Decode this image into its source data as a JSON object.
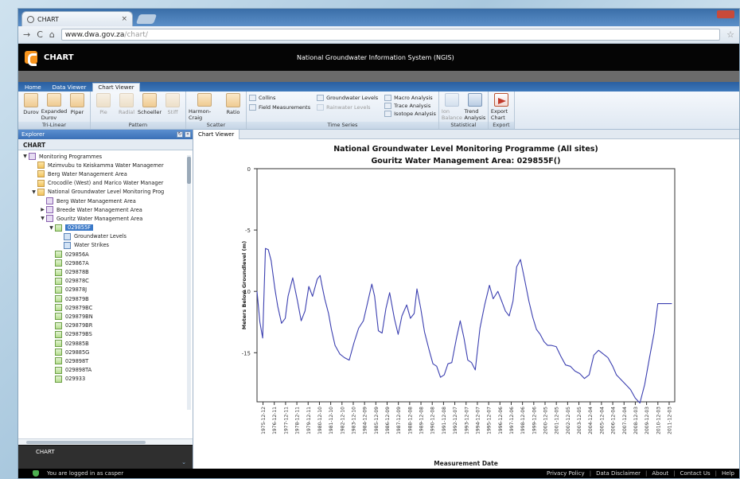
{
  "browser": {
    "tab_title": "CHART",
    "url_host": "www.dwa.gov.za",
    "url_path": "/chart/"
  },
  "app": {
    "name": "CHART",
    "system_title": "National Groundwater Information System (NGIS)"
  },
  "ribbon": {
    "tabs": [
      "Home",
      "Data Viewer",
      "Chart Viewer"
    ],
    "active_tab": "Chart Viewer",
    "groups": {
      "trilinear": {
        "name": "Tri-Linear",
        "buttons": [
          "Durov",
          "Expanded Durov",
          "Piper"
        ]
      },
      "pattern": {
        "name": "Pattern",
        "buttons": [
          "Pie",
          "Radial",
          "Schoeller",
          "Stiff"
        ]
      },
      "scatter": {
        "name": "Scatter",
        "buttons": [
          "Harmon-Craig",
          "Ratio"
        ]
      },
      "timeseries": {
        "name": "Time Series",
        "col1": [
          "Collins",
          "Field Measurements"
        ],
        "col2": [
          "Groundwater Levels",
          "Rainwater Levels"
        ],
        "col3": [
          "Macro Analysis",
          "Trace Analysis",
          "Isotope Analysis"
        ]
      },
      "statistical": {
        "name": "Statistical",
        "buttons": [
          "Ion Balance",
          "Trend Analysis"
        ]
      },
      "export": {
        "name": "Export",
        "buttons": [
          "Export Chart"
        ]
      }
    }
  },
  "explorer": {
    "panel_title": "Explorer",
    "root_label": "CHART",
    "tree": [
      {
        "level": 0,
        "toggle": "▼",
        "icon": "prog",
        "label": "Monitoring Programmes"
      },
      {
        "level": 1,
        "toggle": "",
        "icon": "folder",
        "label": "Mzimvubu to Keiskamma Water Managemer"
      },
      {
        "level": 1,
        "toggle": "",
        "icon": "folder",
        "label": "Berg Water Management Area"
      },
      {
        "level": 1,
        "toggle": "",
        "icon": "folder",
        "label": "Crocodile (West) and Marico Water Manager"
      },
      {
        "level": 1,
        "toggle": "▼",
        "icon": "folder",
        "label": "National Groundwater Level Monitoring Prog"
      },
      {
        "level": 2,
        "toggle": "",
        "icon": "prog",
        "label": "Berg Water Management Area"
      },
      {
        "level": 2,
        "toggle": "▶",
        "icon": "prog",
        "label": "Breede Water Management Area"
      },
      {
        "level": 2,
        "toggle": "▼",
        "icon": "prog",
        "label": "Gouritz Water Management Area"
      },
      {
        "level": 3,
        "toggle": "▼",
        "icon": "site",
        "label": "029855F",
        "selected": true
      },
      {
        "level": 4,
        "toggle": "",
        "icon": "level",
        "label": "Groundwater Levels"
      },
      {
        "level": 4,
        "toggle": "",
        "icon": "level",
        "label": "Water Strikes"
      },
      {
        "level": 3,
        "toggle": "",
        "icon": "site",
        "label": "029856A"
      },
      {
        "level": 3,
        "toggle": "",
        "icon": "site",
        "label": "029867A"
      },
      {
        "level": 3,
        "toggle": "",
        "icon": "site",
        "label": "029878B"
      },
      {
        "level": 3,
        "toggle": "",
        "icon": "site",
        "label": "029878C"
      },
      {
        "level": 3,
        "toggle": "",
        "icon": "site",
        "label": "029878J"
      },
      {
        "level": 3,
        "toggle": "",
        "icon": "site",
        "label": "029879B"
      },
      {
        "level": 3,
        "toggle": "",
        "icon": "site",
        "label": "029879BC"
      },
      {
        "level": 3,
        "toggle": "",
        "icon": "site",
        "label": "029879BN"
      },
      {
        "level": 3,
        "toggle": "",
        "icon": "site",
        "label": "029879BR"
      },
      {
        "level": 3,
        "toggle": "",
        "icon": "site",
        "label": "029879BS"
      },
      {
        "level": 3,
        "toggle": "",
        "icon": "site",
        "label": "029885B"
      },
      {
        "level": 3,
        "toggle": "",
        "icon": "site",
        "label": "029885G"
      },
      {
        "level": 3,
        "toggle": "",
        "icon": "site",
        "label": "029898T"
      },
      {
        "level": 3,
        "toggle": "",
        "icon": "site",
        "label": "029898TA"
      },
      {
        "level": 3,
        "toggle": "",
        "icon": "site",
        "label": "029933"
      }
    ],
    "bottom_panel_title": "CHART"
  },
  "viewer": {
    "tab_label": "Chart Viewer"
  },
  "chart_data": {
    "type": "line",
    "title": "National Groundwater Level Monitoring Programme (All sites)",
    "subtitle": "Gouritz Water Management Area: 029855F()",
    "xlabel": "Measurement Date",
    "ylabel": "Meters Below Groundlevel (m)",
    "ylim": [
      0,
      -19
    ],
    "yticks": [
      0,
      -5,
      -10,
      -15
    ],
    "xlim": [
      "1975-06-01",
      "2012-06-01"
    ],
    "xticks": [
      "1975-12-12",
      "1976-12-11",
      "1977-12-11",
      "1978-12-11",
      "1979-12-11",
      "1980-12-10",
      "1981-12-10",
      "1982-12-10",
      "1983-12-10",
      "1984-12-09",
      "1985-12-09",
      "1986-12-09",
      "1987-12-09",
      "1988-12-08",
      "1989-12-08",
      "1990-12-08",
      "1991-12-08",
      "1992-12-07",
      "1993-12-07",
      "1994-12-07",
      "1995-12-07",
      "1996-12-06",
      "1997-12-06",
      "1998-12-06",
      "1999-12-06",
      "2000-12-05",
      "2001-12-05",
      "2002-12-05",
      "2003-12-05",
      "2004-12-04",
      "2005-12-04",
      "2006-12-04",
      "2007-12-04",
      "2008-12-03",
      "2009-12-03",
      "2010-12-03",
      "2011-12-03"
    ],
    "grid": false,
    "series": [
      {
        "color": "#3b3fb0",
        "x": [
          "1975-06-01",
          "1975-09-01",
          "1975-12-01",
          "1976-03-01",
          "1976-06-01",
          "1976-09-01",
          "1977-01-01",
          "1977-04-01",
          "1977-08-01",
          "1977-12-01",
          "1978-03-01",
          "1978-08-01",
          "1979-01-01",
          "1979-05-01",
          "1979-09-01",
          "1980-01-01",
          "1980-05-01",
          "1980-10-01",
          "1981-01-01",
          "1981-03-01",
          "1981-06-01",
          "1981-10-01",
          "1982-01-01",
          "1982-05-01",
          "1982-10-01",
          "1983-03-01",
          "1983-08-01",
          "1984-01-01",
          "1984-06-01",
          "1984-11-01",
          "1985-03-01",
          "1985-08-01",
          "1985-11-01",
          "1986-03-01",
          "1986-07-01",
          "1986-11-01",
          "1987-03-01",
          "1987-08-01",
          "1987-12-01",
          "1988-04-01",
          "1988-09-01",
          "1989-01-01",
          "1989-05-01",
          "1989-08-01",
          "1989-12-01",
          "1990-04-01",
          "1990-09-01",
          "1991-01-01",
          "1991-05-01",
          "1991-09-01",
          "1992-01-01",
          "1992-05-01",
          "1992-09-01",
          "1993-02-01",
          "1993-06-01",
          "1993-10-01",
          "1994-02-01",
          "1994-06-01",
          "1994-10-01",
          "1995-03-01",
          "1995-08-01",
          "1996-01-01",
          "1996-05-01",
          "1996-10-01",
          "1997-02-01",
          "1997-06-01",
          "1997-10-01",
          "1998-02-01",
          "1998-06-01",
          "1998-10-01",
          "1999-02-01",
          "1999-07-01",
          "1999-11-01",
          "2000-03-01",
          "2000-07-01",
          "2000-11-01",
          "2001-03-01",
          "2001-07-01",
          "2001-12-01",
          "2002-05-01",
          "2002-10-01",
          "2003-03-01",
          "2003-08-01",
          "2004-01-01",
          "2004-06-01",
          "2004-11-01",
          "2005-04-01",
          "2005-09-01",
          "2006-02-01",
          "2006-07-01",
          "2006-12-01",
          "2007-04-01",
          "2007-09-01",
          "2008-02-01",
          "2008-07-01",
          "2008-12-01",
          "2009-05-01",
          "2009-10-01",
          "2010-03-01",
          "2010-08-01",
          "2010-12-01",
          "2011-04-01",
          "2011-08-01",
          "2011-12-01",
          "2012-03-01"
        ],
        "y": [
          -10.0,
          -12.5,
          -13.8,
          -6.5,
          -6.6,
          -7.5,
          -9.8,
          -11.2,
          -12.6,
          -12.2,
          -10.4,
          -8.9,
          -10.8,
          -12.4,
          -11.6,
          -9.6,
          -10.4,
          -9.0,
          -8.7,
          -9.5,
          -10.6,
          -11.8,
          -13.1,
          -14.4,
          -15.1,
          -15.4,
          -15.6,
          -14.2,
          -13.0,
          -12.4,
          -11.1,
          -9.4,
          -10.4,
          -13.2,
          -13.4,
          -11.4,
          -10.1,
          -12.2,
          -13.5,
          -12.0,
          -11.1,
          -12.2,
          -11.8,
          -9.8,
          -11.4,
          -13.3,
          -14.8,
          -15.9,
          -16.1,
          -17.0,
          -16.8,
          -15.9,
          -15.8,
          -13.8,
          -12.4,
          -13.8,
          -15.6,
          -15.8,
          -16.4,
          -13.0,
          -11.1,
          -9.5,
          -10.6,
          -10.0,
          -10.8,
          -11.6,
          -12.0,
          -10.8,
          -8.0,
          -7.4,
          -8.9,
          -10.8,
          -12.1,
          -13.1,
          -13.5,
          -14.1,
          -14.4,
          -14.4,
          -14.5,
          -15.3,
          -16.0,
          -16.1,
          -16.5,
          -16.7,
          -17.1,
          -16.8,
          -15.2,
          -14.8,
          -15.1,
          -15.4,
          -16.1,
          -16.8,
          -17.2,
          -17.6,
          -18.0,
          -18.7,
          -19.1,
          -17.6,
          -15.5,
          -13.4,
          -11.0,
          -11.0,
          -11.0,
          -11.0,
          -11.0
        ]
      }
    ]
  },
  "status": {
    "logged_in": "You are logged in as casper",
    "links": [
      "Privacy Policy",
      "Data Disclaimer",
      "About",
      "Contact Us",
      "Help"
    ]
  }
}
